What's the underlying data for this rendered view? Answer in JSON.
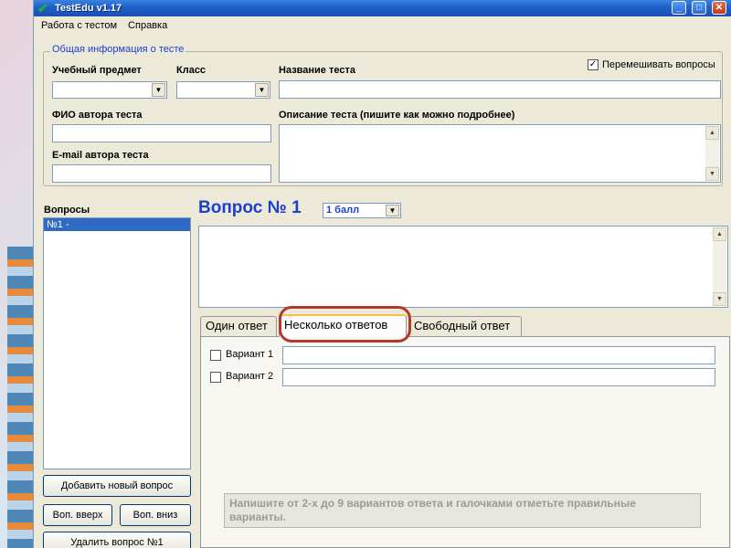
{
  "window": {
    "title": "TestEdu v1.17",
    "minimize": "_",
    "maximize": "□",
    "close": "✕"
  },
  "menu": {
    "items": [
      "Работа с тестом",
      "Справка"
    ]
  },
  "general_info": {
    "legend": "Общая информация о тесте",
    "subject_label": "Учебный предмет",
    "subject_value": "",
    "class_label": "Класс",
    "class_value": "",
    "test_name_label": "Название теста",
    "test_name_value": "",
    "shuffle_label": "Перемешивать вопросы",
    "shuffle_checked": true,
    "author_label": "ФИО автора теста",
    "author_value": "",
    "description_label": "Описание теста (пишите как можно подробнее)",
    "description_value": "",
    "email_label": "E-mail автора теста",
    "email_value": ""
  },
  "questions": {
    "label": "Вопросы",
    "items": [
      "№1 -"
    ],
    "add_button": "Добавить новый вопрос",
    "up_button": "Воп. вверх",
    "down_button": "Воп. вниз",
    "delete_button": "Удалить вопрос №1"
  },
  "question": {
    "title": "Вопрос № 1",
    "points": "1 балл",
    "text": ""
  },
  "tabs": [
    {
      "label": "Один ответ",
      "active": false
    },
    {
      "label": "Несколько ответов",
      "active": true
    },
    {
      "label": "Свободный ответ",
      "active": false
    }
  ],
  "answers": [
    {
      "label": "Вариант 1",
      "value": "",
      "checked": false
    },
    {
      "label": "Вариант 2",
      "value": "",
      "checked": false
    }
  ],
  "hint": "Напишите от 2-х до 9 вариантов ответа и галочками отметьте правильные варианты.",
  "colors": {
    "accent": "#1a3fd1",
    "selection": "#316ac5",
    "annotation": "#b03a2e"
  }
}
